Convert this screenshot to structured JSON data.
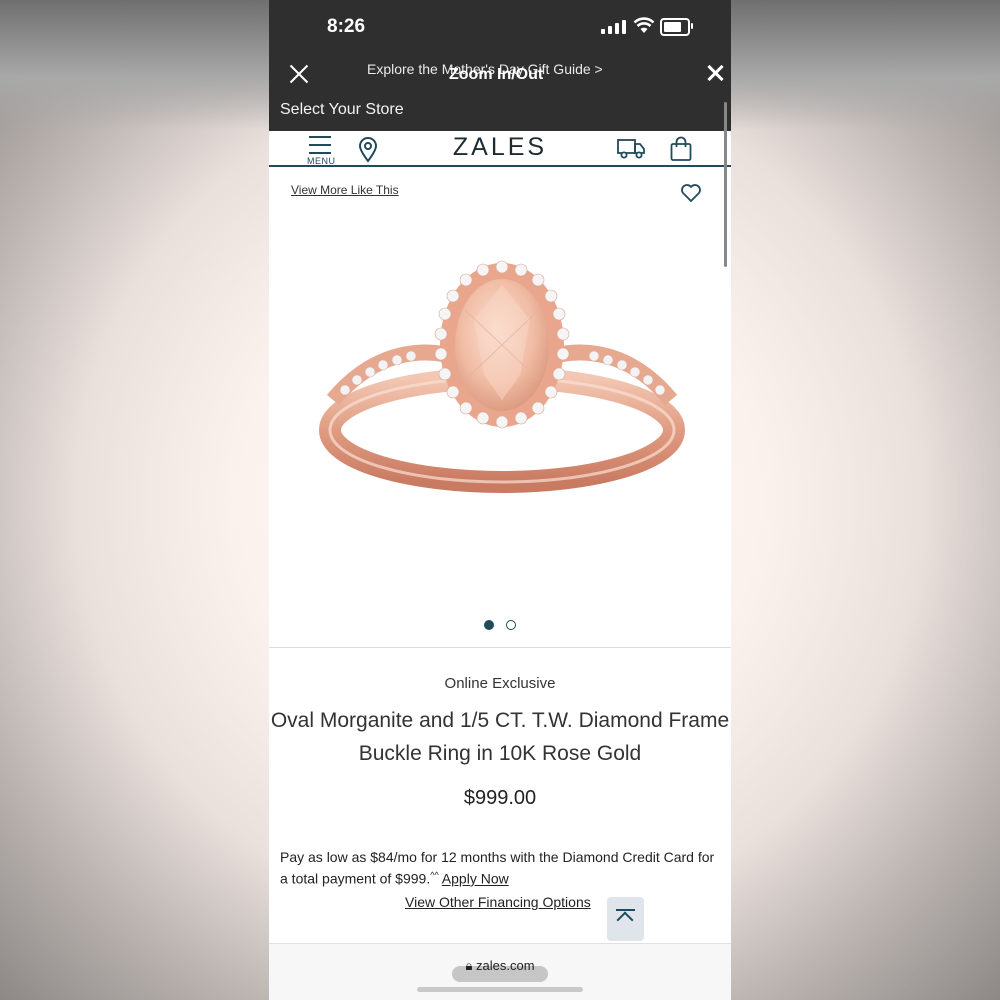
{
  "status": {
    "time": "8:26"
  },
  "browser": {
    "promo": "Explore the Mother's Day Gift Guide >",
    "zoom_overlay": "Zoom In/Out",
    "store": "Select Your Store",
    "url": "zales.com"
  },
  "header": {
    "logo": "ZALES",
    "menu_label": "MENU"
  },
  "product": {
    "view_more": "View More Like This",
    "badge": "Online Exclusive",
    "title": "Oval Morganite and 1/5 CT. T.W. Diamond Frame Buckle Ring in 10K Rose Gold",
    "price": "$999.00",
    "financing_text": "Pay as low as $84/mo for 12 months with the Diamond Credit Card for a total payment of $999.",
    "financing_note": "^^",
    "apply_now": "Apply Now",
    "other_financing": "View Other Financing Options",
    "image_dots": {
      "count": 2,
      "active": 1
    }
  },
  "colors": {
    "brand": "#214a5a",
    "chrome": "#2f2f2f",
    "rose_gold": "#e3a48c"
  },
  "icons": [
    "close-icon",
    "menu-icon",
    "location-pin-icon",
    "truck-icon",
    "shopping-bag-icon",
    "heart-icon",
    "back-to-top-icon",
    "lock-icon"
  ]
}
